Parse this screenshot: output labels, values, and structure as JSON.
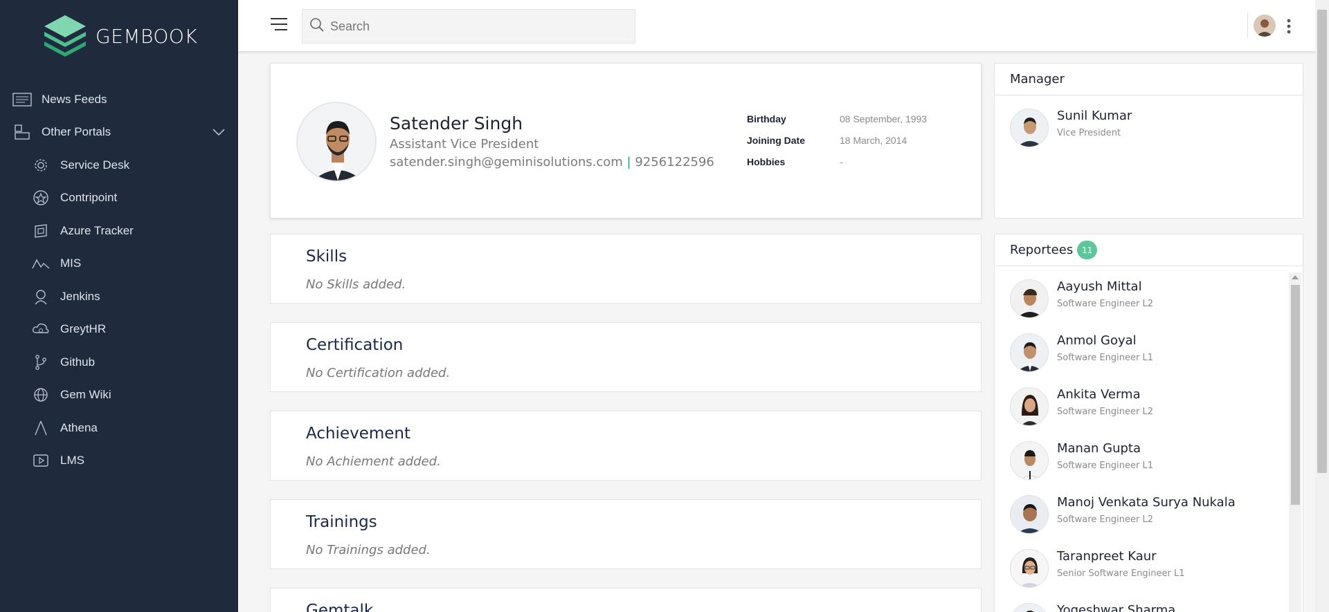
{
  "brand": {
    "name": "GEMBOOK"
  },
  "sidebar": {
    "items": [
      {
        "label": "News Feeds",
        "icon": "news-feed-icon",
        "level": "top"
      },
      {
        "label": "Other Portals",
        "icon": "portals-icon",
        "level": "top",
        "expanded": true
      },
      {
        "label": "Service Desk",
        "icon": "gear-icon",
        "level": "sub"
      },
      {
        "label": "Contripoint",
        "icon": "star-badge-icon",
        "level": "sub"
      },
      {
        "label": "Azure Tracker",
        "icon": "tracker-icon",
        "level": "sub"
      },
      {
        "label": "MIS",
        "icon": "chart-line-icon",
        "level": "sub"
      },
      {
        "label": "Jenkins",
        "icon": "jenkins-icon",
        "level": "sub"
      },
      {
        "label": "GreytHR",
        "icon": "cloud-user-icon",
        "level": "sub"
      },
      {
        "label": "Github",
        "icon": "git-branch-icon",
        "level": "sub"
      },
      {
        "label": "Gem Wiki",
        "icon": "globe-icon",
        "level": "sub"
      },
      {
        "label": "Athena",
        "icon": "triangle-icon",
        "level": "sub"
      },
      {
        "label": "LMS",
        "icon": "video-icon",
        "level": "sub"
      }
    ]
  },
  "search": {
    "placeholder": "Search",
    "value": ""
  },
  "profile": {
    "name": "Satender Singh",
    "title": "Assistant Vice President",
    "email": "satender.singh@geminisolutions.com",
    "separator": "|",
    "phone": "9256122596",
    "details": [
      {
        "label": "Birthday",
        "value": "08 September, 1993"
      },
      {
        "label": "Joining Date",
        "value": "18 March, 2014"
      },
      {
        "label": "Hobbies",
        "value": "-"
      }
    ]
  },
  "sections": [
    {
      "title": "Skills",
      "empty": "No Skills added."
    },
    {
      "title": "Certification",
      "empty": "No Certification added."
    },
    {
      "title": "Achievement",
      "empty": "No Achiement added."
    },
    {
      "title": "Trainings",
      "empty": "No Trainings added."
    },
    {
      "title": "Gemtalk",
      "empty": ""
    }
  ],
  "manager": {
    "header": "Manager",
    "name": "Sunil Kumar",
    "role": "Vice President"
  },
  "reportees": {
    "header": "Reportees",
    "count": "11",
    "people": [
      {
        "name": "Aayush Mittal",
        "role": "Software Engineer L2"
      },
      {
        "name": "Anmol Goyal",
        "role": "Software Engineer L1"
      },
      {
        "name": "Ankita Verma",
        "role": "Software Engineer L2"
      },
      {
        "name": "Manan Gupta",
        "role": "Software Engineer L1"
      },
      {
        "name": "Manoj Venkata Surya Nukala",
        "role": "Software Engineer L2"
      },
      {
        "name": "Taranpreet Kaur",
        "role": "Senior Software Engineer L1"
      },
      {
        "name": "Yogeshwar Sharma",
        "role": ""
      }
    ]
  },
  "colors": {
    "sidebar_bg": "#1f2a3c",
    "accent_green": "#5fc59a",
    "heading_navy": "#1a2848"
  }
}
